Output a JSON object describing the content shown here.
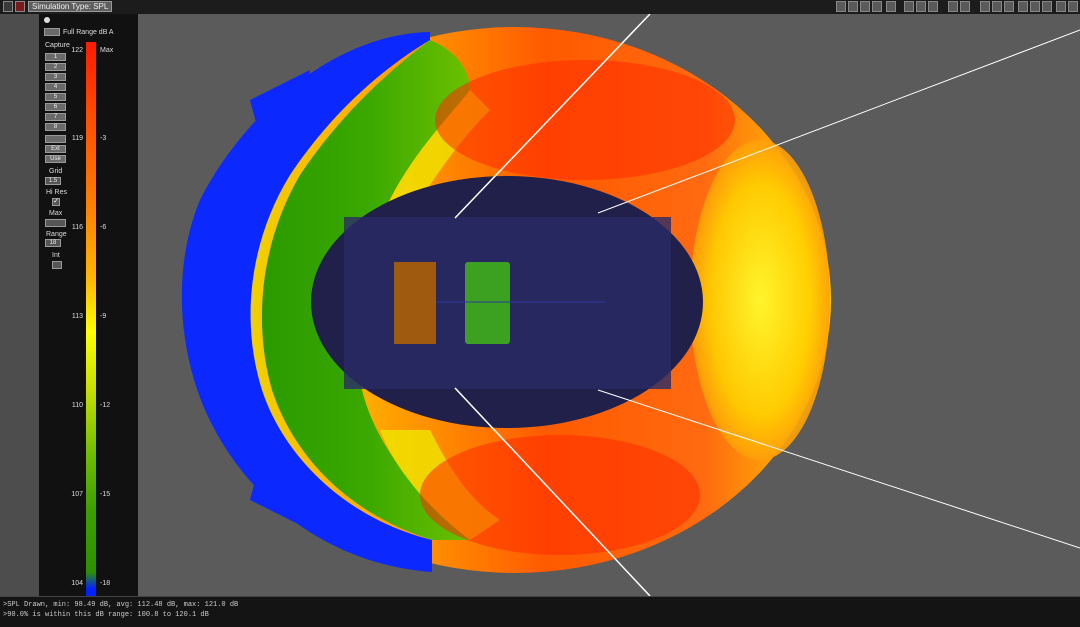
{
  "toolbar": {
    "simulation_type": "Simulation Type: SPL"
  },
  "panel": {
    "range_button": "Full Range dB A",
    "capture_label": "Capture",
    "capture_buttons": [
      "1",
      "2",
      "3",
      "4",
      "5",
      "6",
      "7",
      "8",
      "",
      "Ext",
      "Use"
    ],
    "grid_label": "Grid",
    "grid_value": "1.5",
    "hires_label": "Hi Res",
    "max_label": "Max",
    "range_label": "Range",
    "range_value": "18",
    "int_label": "Int"
  },
  "scale": {
    "db_ticks": [
      "122",
      "119",
      "116",
      "113",
      "110",
      "107",
      "104"
    ],
    "rel_ticks": [
      "Max",
      "-3",
      "-6",
      "-9",
      "-12",
      "-15",
      "-18"
    ]
  },
  "console": {
    "line1": ">SPL Drawn, min: 98.49 dB, avg: 112.48 dB, max: 121.0 dB",
    "line2": ">90.0% is within this dB range: 100.8 to 120.1 dB"
  },
  "colors": {
    "max": "#ff1a00",
    "mid": "#ffff00",
    "low": "#3aa000",
    "out_of_range": "#0020ff",
    "field": "#20204a"
  }
}
